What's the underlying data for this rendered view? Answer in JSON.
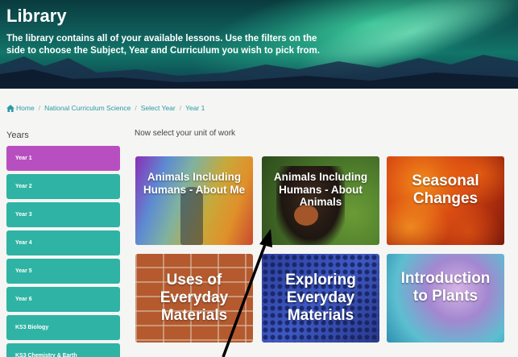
{
  "banner": {
    "title": "Library",
    "description": "The library contains all of your available lessons. Use the filters on the side to choose the Subject, Year and Curriculum you wish to pick from."
  },
  "breadcrumb": {
    "home_icon": "home-icon",
    "items": [
      "Home",
      "National Curriculum Science",
      "Select Year",
      "Year 1"
    ]
  },
  "sidebar": {
    "heading": "Years",
    "items": [
      {
        "label": "Year 1",
        "active": true
      },
      {
        "label": "Year 2"
      },
      {
        "label": "Year 3"
      },
      {
        "label": "Year 4"
      },
      {
        "label": "Year 5"
      },
      {
        "label": "Year 6"
      },
      {
        "label": "KS3 Biology"
      },
      {
        "label": "KS3 Chemistry & Earth"
      }
    ]
  },
  "main": {
    "heading": "Now select your unit of work",
    "units": [
      {
        "title": "Animals Including Humans - About Me"
      },
      {
        "title": "Animals Including Humans - About Animals"
      },
      {
        "title": "Seasonal Changes"
      },
      {
        "title": "Uses of Everyday Materials"
      },
      {
        "title": "Exploring Everyday Materials"
      },
      {
        "title": "Introduction to Plants"
      }
    ]
  },
  "colors": {
    "accent_teal": "#2fb3a4",
    "active_purple": "#b84fc0",
    "link": "#2a9aa6"
  }
}
